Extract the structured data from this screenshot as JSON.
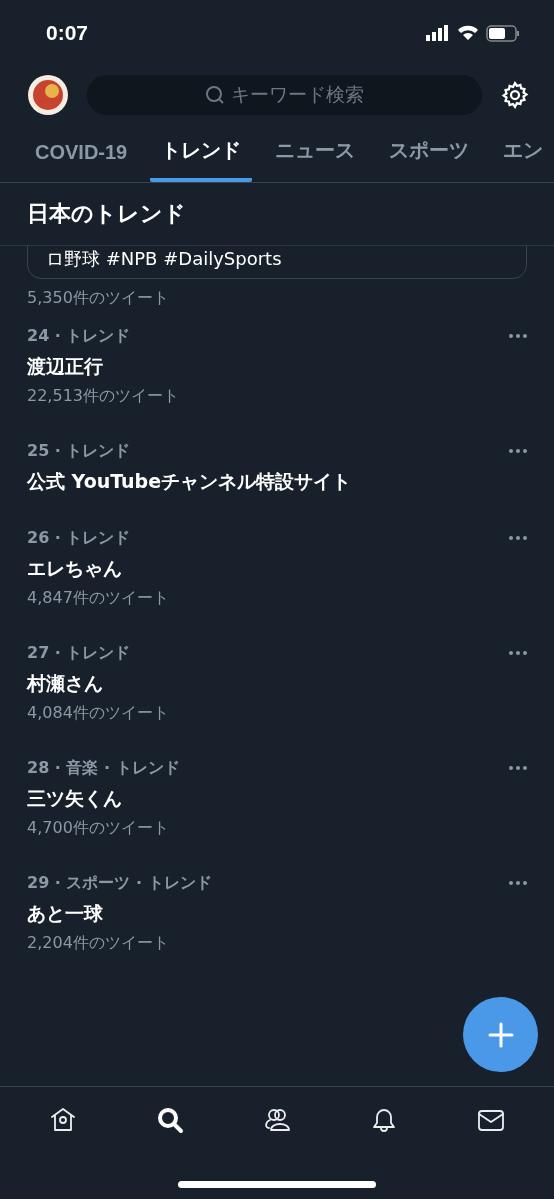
{
  "status_bar": {
    "time": "0:07"
  },
  "search": {
    "placeholder": "キーワード検索"
  },
  "tabs": [
    {
      "label": "COVID-19",
      "selected": false
    },
    {
      "label": "トレンド",
      "selected": true
    },
    {
      "label": "ニュース",
      "selected": false
    },
    {
      "label": "スポーツ",
      "selected": false
    },
    {
      "label": "エン",
      "selected": false
    }
  ],
  "section_title": "日本のトレンド",
  "partial_card": {
    "text": "ロ野球 #NPB #DailySports"
  },
  "partial_count": "5,350件のツイート",
  "trends": [
    {
      "meta": "24 · トレンド",
      "title": "渡辺正行",
      "count": "22,513件のツイート"
    },
    {
      "meta": "25 · トレンド",
      "title": "公式 YouTubeチャンネル特設サイト"
    },
    {
      "meta": "26 · トレンド",
      "title": "エレちゃん",
      "count": "4,847件のツイート"
    },
    {
      "meta": "27 · トレンド",
      "title": "村瀬さん",
      "count": "4,084件のツイート"
    },
    {
      "meta": "28 · 音楽 · トレンド",
      "title": "三ツ矢くん",
      "count": "4,700件のツイート"
    },
    {
      "meta": "29 · スポーツ · トレンド",
      "title": "あと一球",
      "count": "2,204件のツイート"
    }
  ],
  "bottom_nav": [
    {
      "kind": "home",
      "selected": false
    },
    {
      "kind": "search",
      "selected": true
    },
    {
      "kind": "people",
      "selected": false
    },
    {
      "kind": "bell",
      "selected": false
    },
    {
      "kind": "mail",
      "selected": false
    }
  ]
}
